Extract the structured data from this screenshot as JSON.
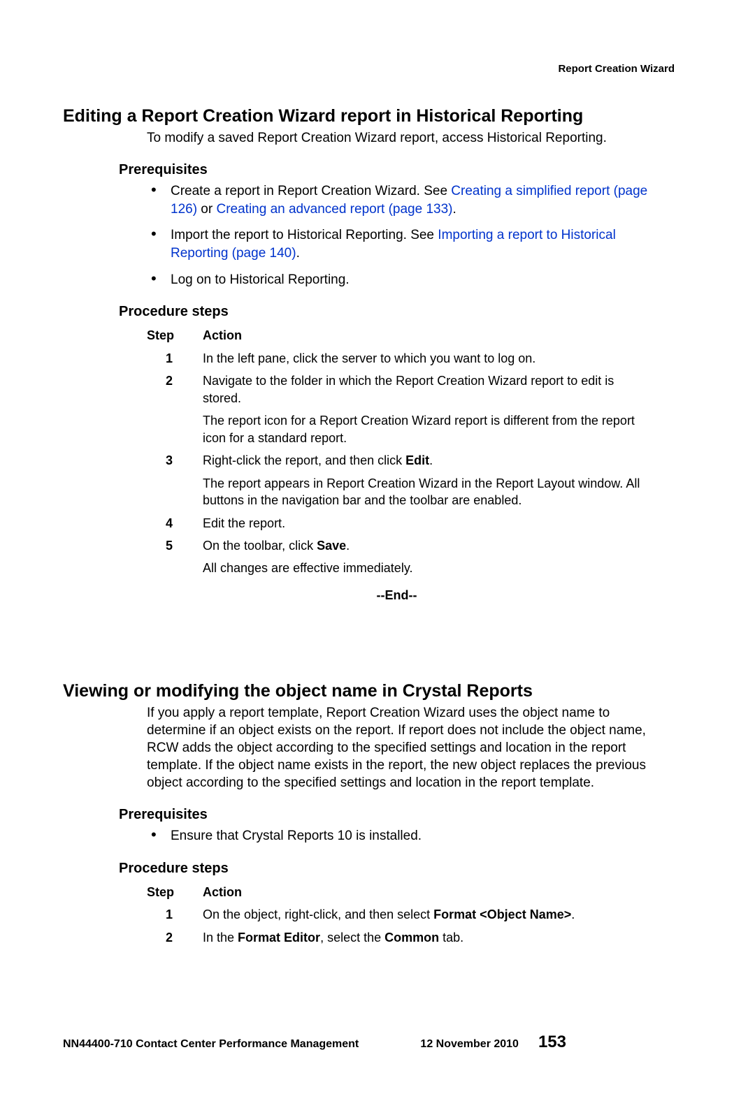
{
  "running_head": "Report Creation Wizard",
  "section1": {
    "title": "Editing a Report Creation Wizard report in Historical Reporting",
    "intro": "To modify a saved Report Creation Wizard report, access Historical Reporting.",
    "prereq_heading": "Prerequisites",
    "prereq": {
      "item1": {
        "pre": "Create a report in Report Creation Wizard. See ",
        "link1": "Creating a simplified report (page 126)",
        "mid": " or ",
        "link2": "Creating an advanced report (page 133)",
        "post": "."
      },
      "item2": {
        "pre": "Import the report to Historical Reporting. See ",
        "link": "Importing a report to Historical Reporting (page 140)",
        "post": "."
      },
      "item3": "Log on to Historical Reporting."
    },
    "steps_heading": "Procedure steps",
    "table": {
      "col_step": "Step",
      "col_action": "Action",
      "rows": {
        "n1": "1",
        "a1": "In the left pane, click the server to which you want to log on.",
        "n2": "2",
        "a2": "Navigate to the folder in which the Report Creation Wizard report to edit is stored.",
        "a2b": "The report icon for a Report Creation Wizard report is different from the report icon for a standard report.",
        "n3": "3",
        "a3_pre": "Right-click the report, and then click ",
        "a3_b": "Edit",
        "a3_post": ".",
        "a3b": "The report appears in Report Creation Wizard in the Report Layout window. All buttons in the navigation bar and the toolbar are enabled.",
        "n4": "4",
        "a4": "Edit the report.",
        "n5": "5",
        "a5_pre": "On the toolbar, click ",
        "a5_b": "Save",
        "a5_post": ".",
        "a5b": "All changes are effective immediately."
      }
    },
    "end": "--End--"
  },
  "section2": {
    "title": "Viewing or modifying the object name in Crystal Reports",
    "intro": "If you apply a report template, Report Creation Wizard uses the object name to determine if an object exists on the report. If report does not include the object name, RCW adds the object according to the specified settings and location in the report template. If the object name exists in the report, the new object replaces the previous object according to the specified settings and location in the report template.",
    "prereq_heading": "Prerequisites",
    "prereq": {
      "item1": "Ensure that Crystal Reports 10 is installed."
    },
    "steps_heading": "Procedure steps",
    "table": {
      "col_step": "Step",
      "col_action": "Action",
      "rows": {
        "n1": "1",
        "a1_pre": "On the object, right-click, and then select ",
        "a1_b": "Format <Object Name>",
        "a1_post": ".",
        "n2": "2",
        "a2_pre": "In the ",
        "a2_b1": "Format Editor",
        "a2_mid": ", select the ",
        "a2_b2": "Common",
        "a2_post": " tab."
      }
    }
  },
  "footer": {
    "doc": "NN44400-710 Contact Center Performance Management",
    "date": "12 November 2010",
    "page": "153"
  }
}
